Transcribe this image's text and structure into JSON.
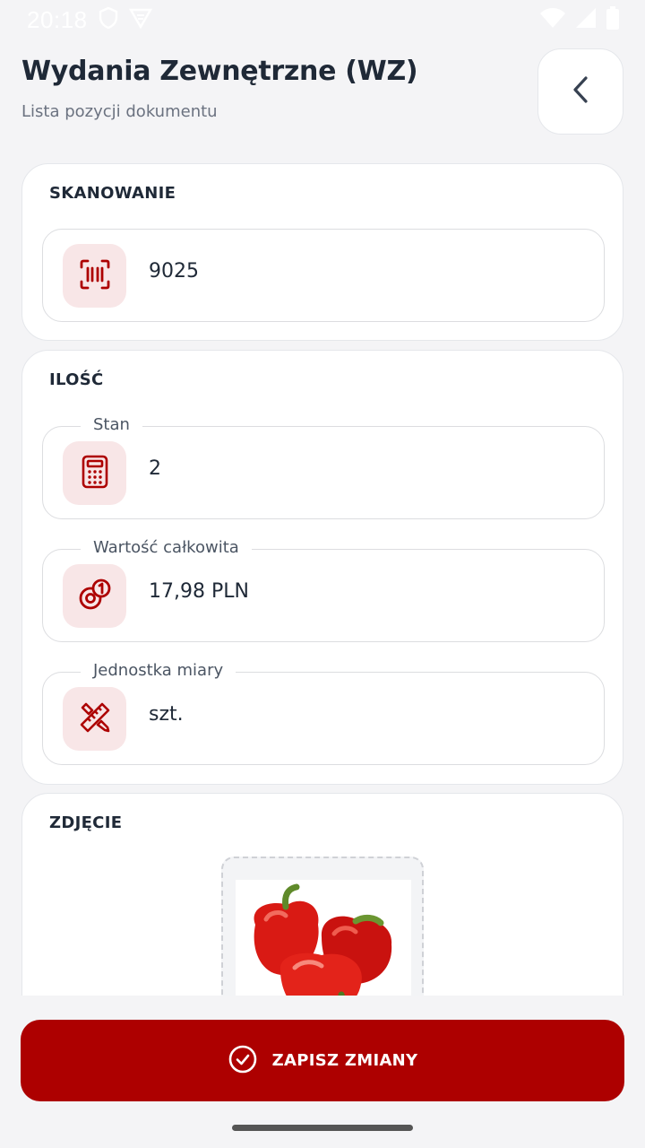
{
  "status_bar": {
    "time": "20:18",
    "icons": [
      "shield-icon",
      "app-icon",
      "wifi-icon",
      "signal-icon",
      "battery-icon"
    ]
  },
  "header": {
    "title": "Wydania Zewnętrzne (WZ)",
    "subtitle": "Lista pozycji dokumentu",
    "back_icon": "chevron-left-icon"
  },
  "scan_section": {
    "title": "SKANOWANIE",
    "field": {
      "icon": "barcode-scan-icon",
      "value": "9025"
    }
  },
  "quantity_section": {
    "title": "ILOŚĆ",
    "fields": [
      {
        "label": "Stan",
        "icon": "calculator-icon",
        "value": "2"
      },
      {
        "label": "Wartość całkowita",
        "icon": "coins-icon",
        "value": "17,98 PLN"
      },
      {
        "label": "Jednostka miary",
        "icon": "ruler-pencil-icon",
        "value": "szt."
      }
    ]
  },
  "photo_section": {
    "title": "ZDJĘCIE",
    "image": "red-bell-peppers-photo"
  },
  "save_button": {
    "label": "ZAPISZ ZMIANY",
    "icon": "check-circle-icon"
  },
  "colors": {
    "accent": "#ad0000",
    "icon_bg": "#f8e6e7",
    "background": "#f4f4f6"
  }
}
